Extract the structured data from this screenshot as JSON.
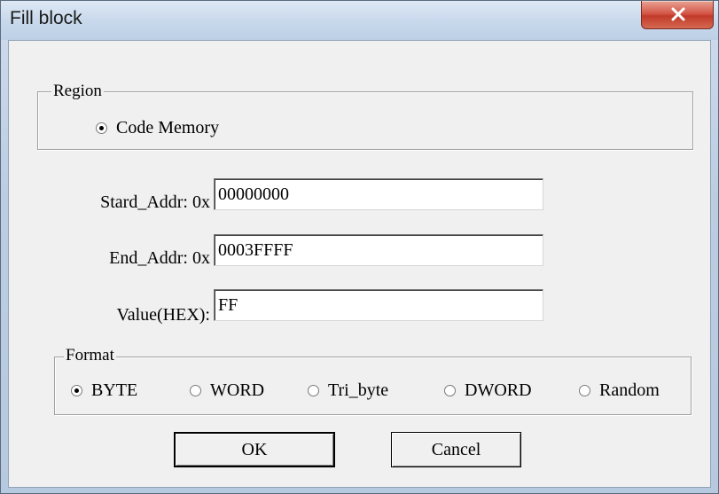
{
  "window": {
    "title": "Fill block"
  },
  "region": {
    "legend": "Region",
    "option_label": "Code Memory"
  },
  "fields": {
    "start_label": "Stard_Addr: 0x",
    "start_value": "00000000",
    "end_label": "End_Addr: 0x",
    "end_value": "0003FFFF",
    "value_label": "Value(HEX):",
    "value_value": "FF"
  },
  "format": {
    "legend": "Format",
    "options": [
      "BYTE",
      "WORD",
      "Tri_byte",
      "DWORD",
      "Random"
    ],
    "selected": "BYTE"
  },
  "buttons": {
    "ok": "OK",
    "cancel": "Cancel"
  },
  "icons": {
    "close": "close-icon"
  },
  "colors": {
    "close_button": "#c8402f",
    "dialog_face": "#f0f0f0",
    "title_bar": "#c9d9ec"
  }
}
